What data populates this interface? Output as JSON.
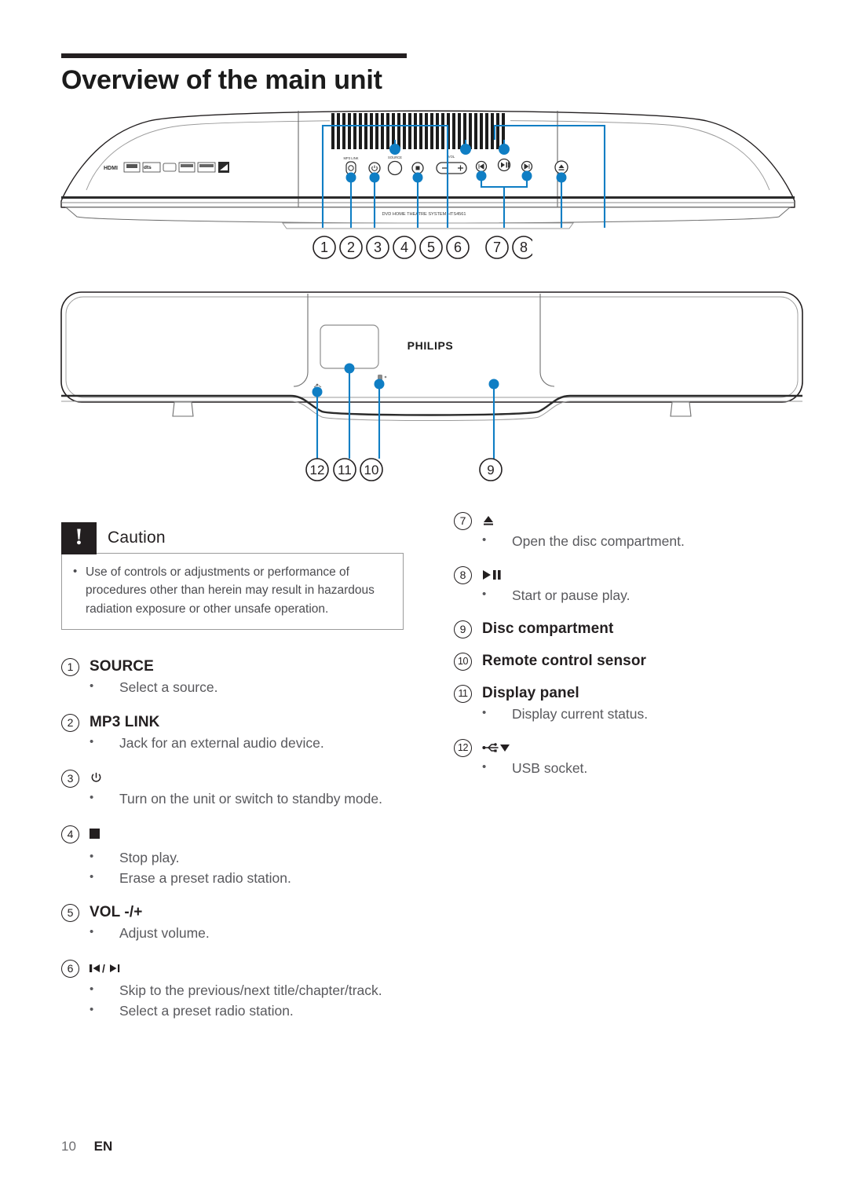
{
  "heading": {
    "title": "Overview of the main unit"
  },
  "figures": {
    "top_unit": {
      "brand_badges": [
        "HDMI",
        "DivX",
        "dts",
        "DSD",
        "Dolby Digital",
        "Dolby",
        "DVD"
      ],
      "model_text": "DVD HOME THEATRE SYSTEM   HTS4561",
      "mp3_link_label": "MP3 LINK",
      "source_label": "SOURCE",
      "vol_label": "VOL",
      "callouts": [
        "1",
        "2",
        "3",
        "4",
        "5",
        "6",
        "7",
        "8"
      ]
    },
    "bottom_unit": {
      "brand": "PHILIPS",
      "callouts": [
        "12",
        "11",
        "10",
        "9"
      ]
    }
  },
  "caution": {
    "badge": "!",
    "title": "Caution",
    "bullet_marker": "•",
    "items": [
      "Use of controls or adjustments or performance of procedures other than herein may result in hazardous radiation exposure or other unsafe operation."
    ]
  },
  "legend": {
    "bullet_marker": "•",
    "left": [
      {
        "num": "1",
        "label": "SOURCE",
        "icon": null,
        "bullets": [
          "Select a source."
        ]
      },
      {
        "num": "2",
        "label": "MP3 LINK",
        "icon": null,
        "bullets": [
          "Jack for an external audio device."
        ]
      },
      {
        "num": "3",
        "label": "",
        "icon": "power-icon",
        "bullets": [
          "Turn on the unit or switch to standby mode."
        ]
      },
      {
        "num": "4",
        "label": "",
        "icon": "stop-icon",
        "bullets": [
          "Stop play.",
          "Erase a preset radio station."
        ]
      },
      {
        "num": "5",
        "label": "VOL -/+",
        "icon": null,
        "bullets": [
          "Adjust volume."
        ]
      },
      {
        "num": "6",
        "label": "",
        "icon": "skip-prev-next-icon",
        "bullets": [
          "Skip to the previous/next title/chapter/track.",
          "Select a preset radio station."
        ]
      }
    ],
    "right": [
      {
        "num": "7",
        "label": "",
        "icon": "eject-icon",
        "bullets": [
          "Open the disc compartment."
        ]
      },
      {
        "num": "8",
        "label": "",
        "icon": "play-pause-icon",
        "bullets": [
          "Start or pause play."
        ]
      },
      {
        "num": "9",
        "label": "Disc compartment",
        "icon": null,
        "bullets": []
      },
      {
        "num": "10",
        "label": "Remote control sensor",
        "icon": null,
        "bullets": []
      },
      {
        "num": "11",
        "label": "Display panel",
        "icon": null,
        "bullets": [
          "Display current status."
        ]
      },
      {
        "num": "12",
        "label": "",
        "icon": "usb-icon",
        "bullets": [
          "USB socket."
        ]
      }
    ]
  },
  "footer": {
    "page": "10",
    "language": "EN"
  },
  "colors": {
    "accent_blue": "#0f7ec4",
    "text_dark": "#231f20",
    "text_gray": "#59595d",
    "rule": "#231f20"
  }
}
